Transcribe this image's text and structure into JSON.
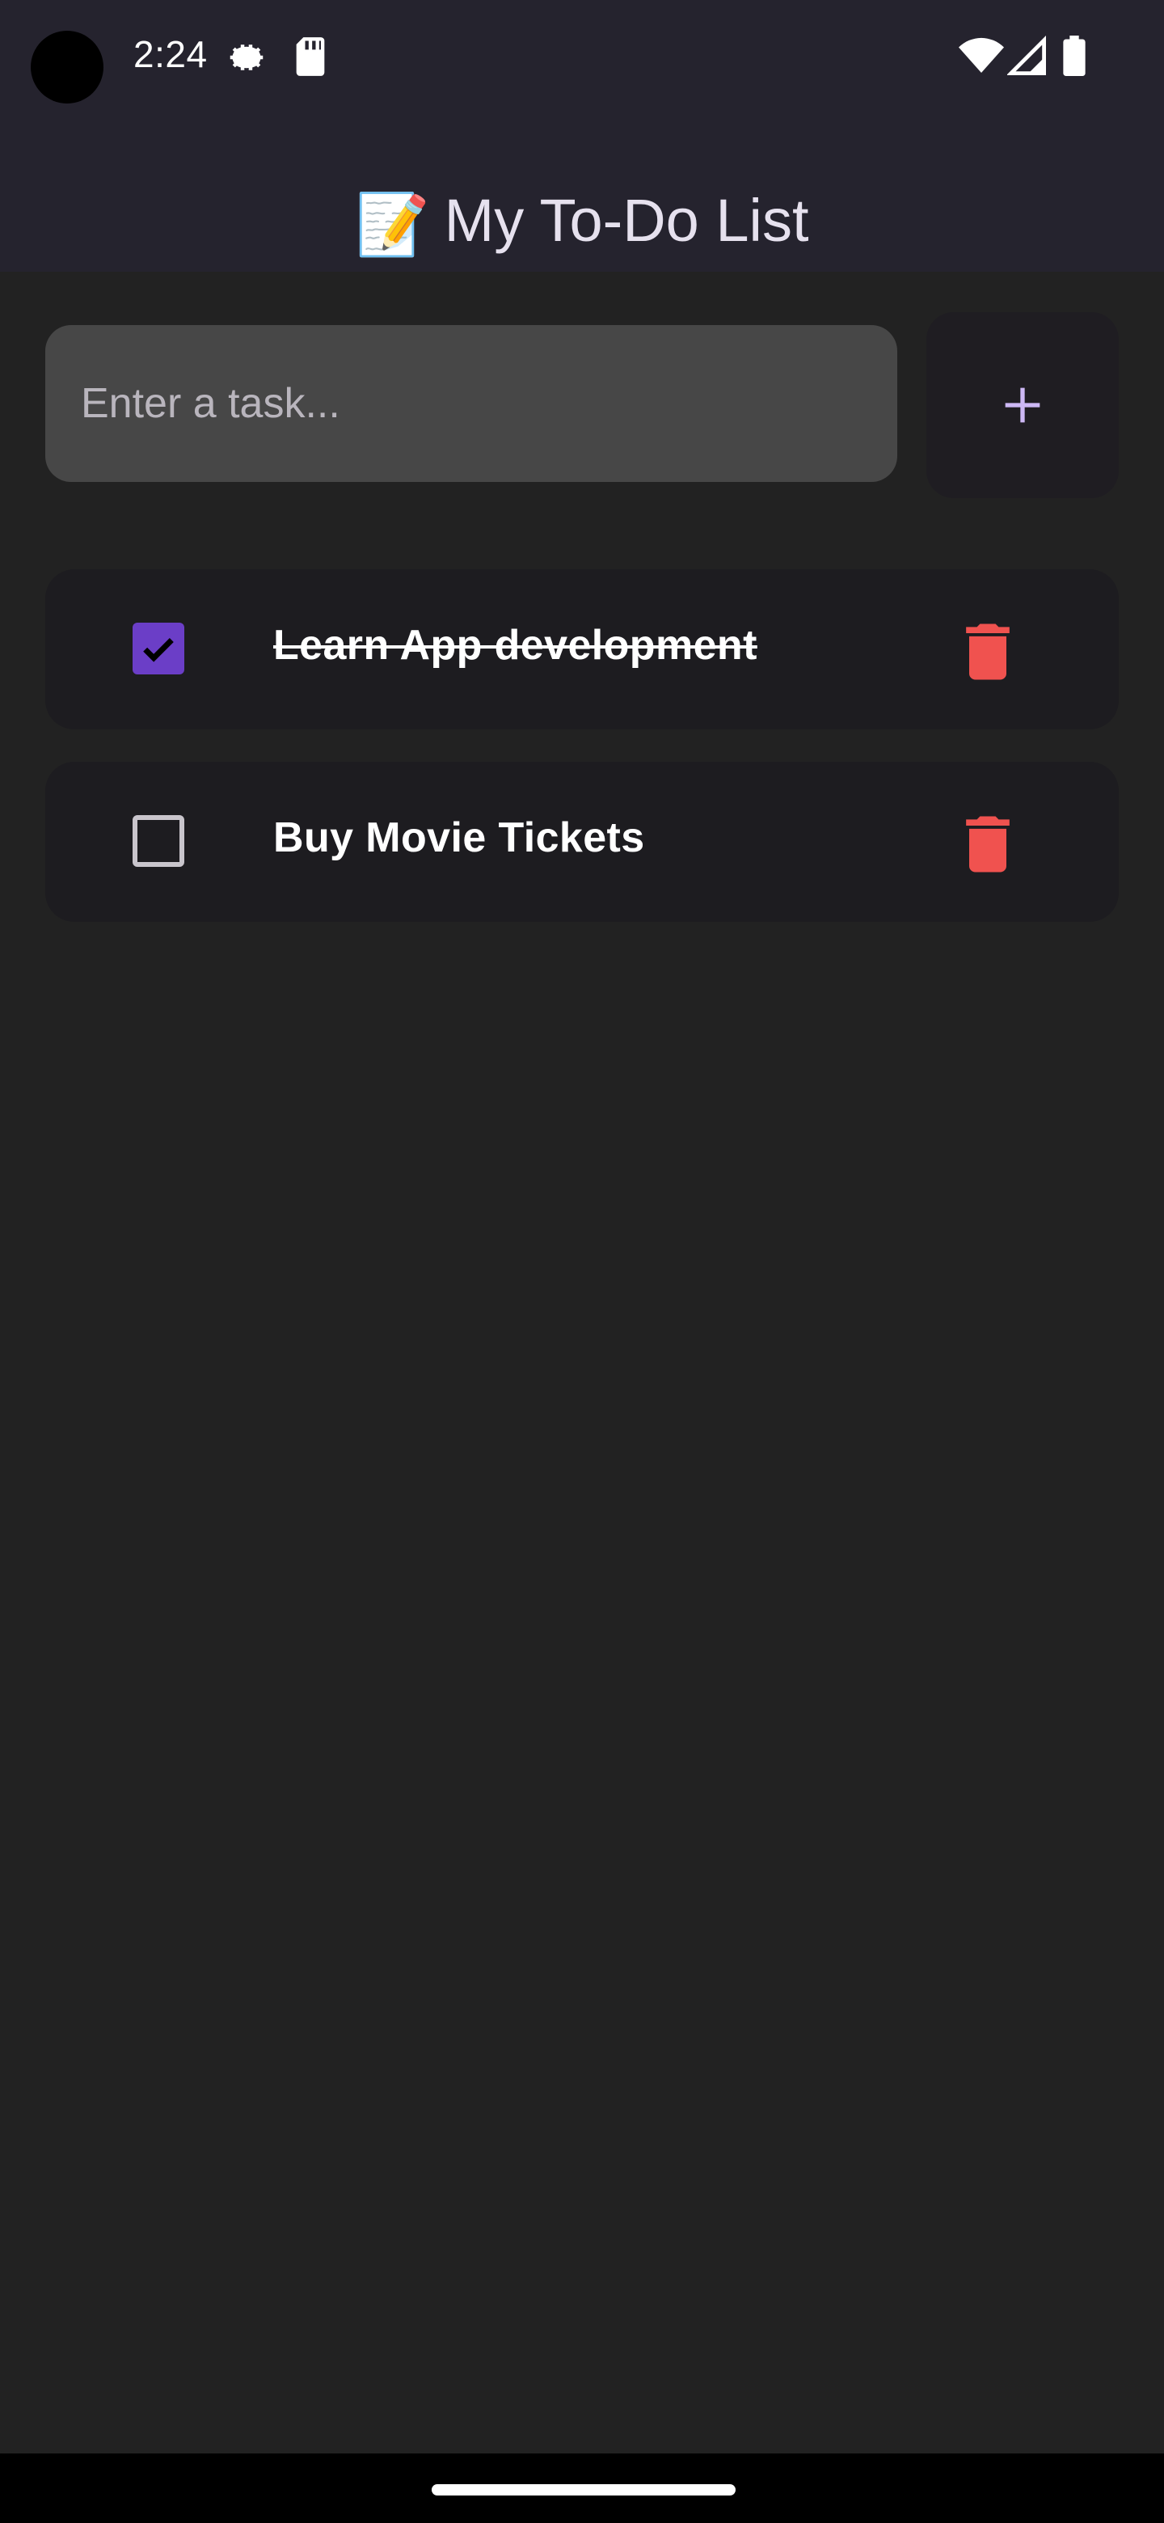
{
  "status_bar": {
    "time": "2:24",
    "icons": [
      "settings-gear-icon",
      "sd-card-icon",
      "wifi-icon",
      "cellular-signal-icon",
      "battery-icon"
    ]
  },
  "header": {
    "emoji": "📝",
    "title": "My To-Do List"
  },
  "input": {
    "placeholder": "Enter a task...",
    "value": "",
    "add_icon": "plus-icon"
  },
  "tasks": [
    {
      "text": "Learn App development",
      "completed": true
    },
    {
      "text": "Buy Movie Tickets",
      "completed": false
    }
  ],
  "colors": {
    "background": "#222222",
    "app_bar": "#25232e",
    "card": "#1d1c20",
    "checkbox_checked": "#6b3ec7",
    "delete_red": "#f0524f",
    "accent_plus": "#cdb8f5"
  }
}
